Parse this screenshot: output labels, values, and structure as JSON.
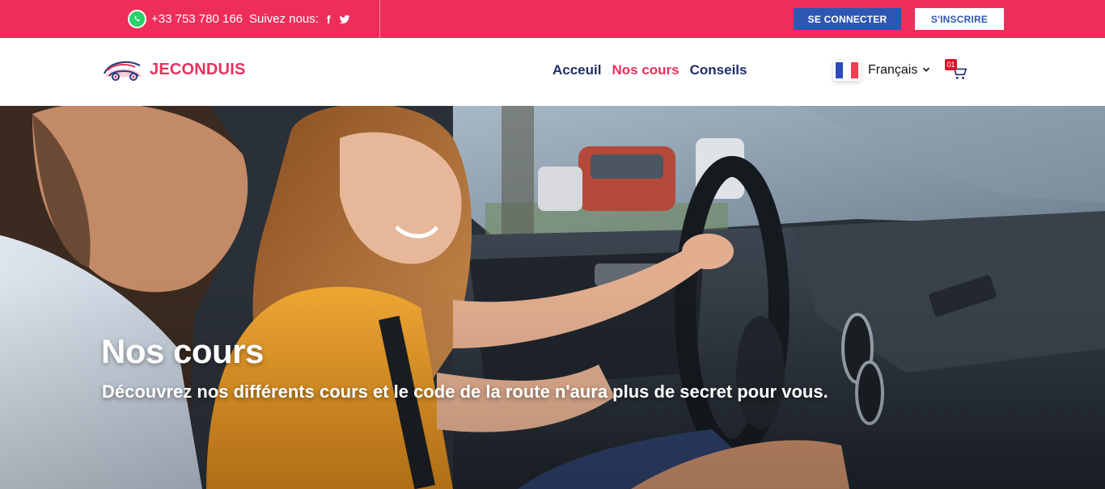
{
  "topbar": {
    "background_color": "#ee2e5a",
    "whatsapp_icon": "whatsapp-icon",
    "phone": "+33 753 780 166",
    "follow_label": "Suivez nous:",
    "social": [
      {
        "icon": "facebook-icon",
        "glyph": "f"
      },
      {
        "icon": "twitter-icon"
      }
    ],
    "login_label": "SE CONNECTER",
    "signup_label": "S'INSCRIRE",
    "login_color": "#2e57b3"
  },
  "header": {
    "logo_text": "JECONDUIS",
    "brand_color": "#e8325e",
    "nav": [
      {
        "label": "Acceuil",
        "active": false
      },
      {
        "label": "Nos cours",
        "active": true
      },
      {
        "label": "Conseils",
        "active": false
      }
    ],
    "nav_color": "#1f2f66",
    "language": {
      "label": "Français",
      "flag": "france-flag-icon"
    },
    "cart": {
      "icon": "cart-icon",
      "count": "01"
    }
  },
  "hero": {
    "title": "Nos cours",
    "subtitle": "Découvrez nos différents cours et le code de la route n'aura plus de secret pour vous."
  }
}
